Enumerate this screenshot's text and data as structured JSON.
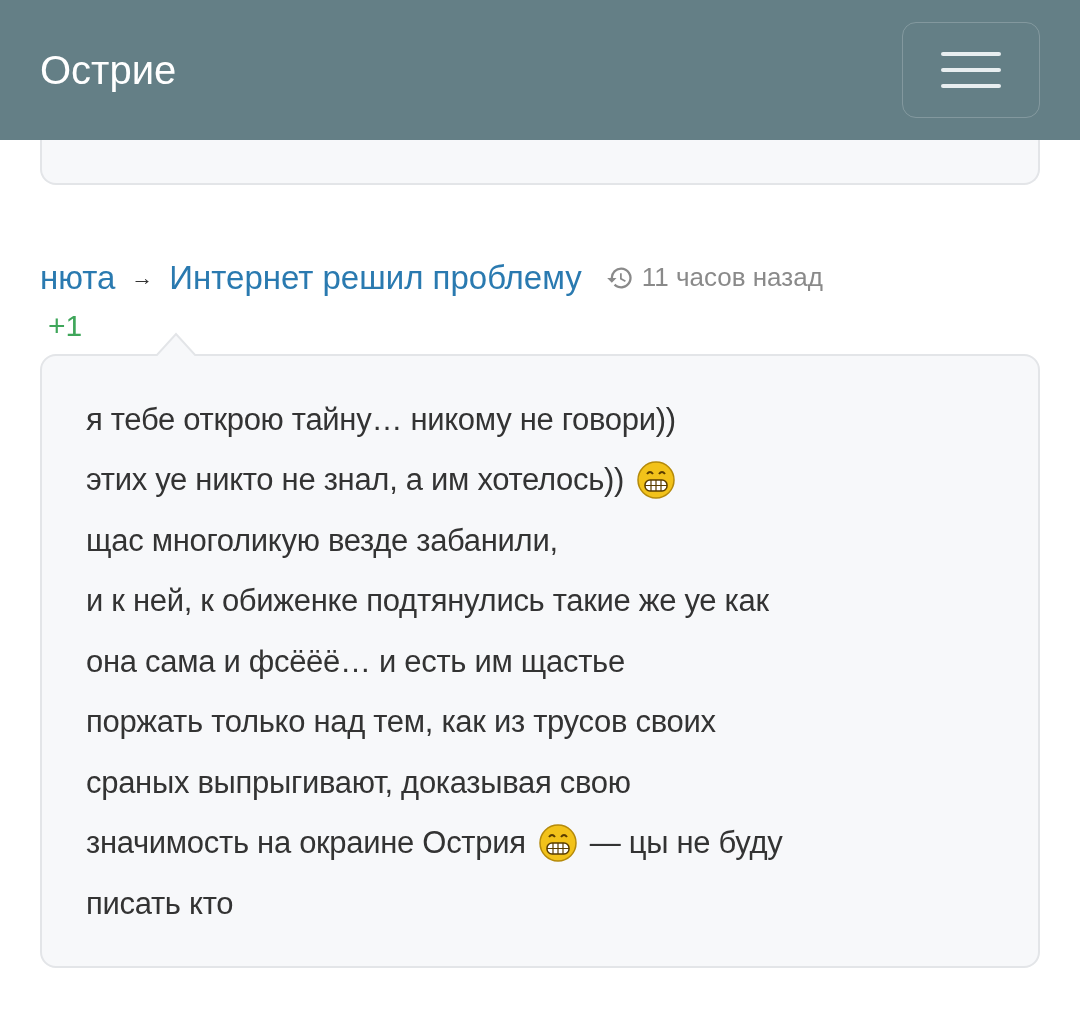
{
  "navbar": {
    "brand": "Острие"
  },
  "comment": {
    "author": "нюта",
    "arrow": "→",
    "post_title": "Интернет решил проблему",
    "time": "11 часов назад",
    "rating": "+1",
    "lines": [
      [
        {
          "kind": "text",
          "text": "я тебе открою тайну… никому не говори))"
        }
      ],
      [
        {
          "kind": "text",
          "text": "этих уе никто не знал, а им хотелось))"
        },
        {
          "kind": "smiley"
        }
      ],
      [
        {
          "kind": "text",
          "text": "щас многоликую везде забанили,"
        }
      ],
      [
        {
          "kind": "text",
          "text": "и к ней, к обиженке подтянулись такие же уе как"
        }
      ],
      [
        {
          "kind": "text",
          "text": "она сама и фсёёё… и есть им щастье"
        }
      ],
      [
        {
          "kind": "text",
          "text": "поржать только над тем, как из трусов своих"
        }
      ],
      [
        {
          "kind": "text",
          "text": "сраных выпрыгивают, доказывая свою"
        }
      ],
      [
        {
          "kind": "text",
          "text": "значимость на окраине Острия"
        },
        {
          "kind": "smiley"
        },
        {
          "kind": "text",
          "text": "— цы не буду"
        }
      ],
      [
        {
          "kind": "text",
          "text": "писать кто"
        }
      ]
    ]
  }
}
